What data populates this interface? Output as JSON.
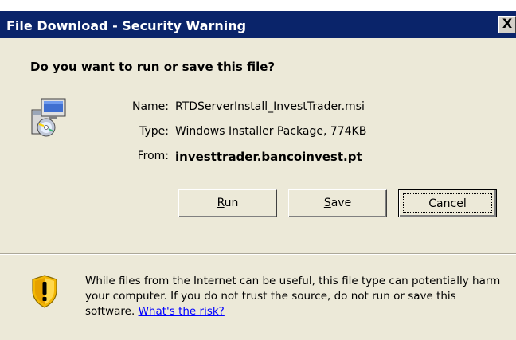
{
  "window": {
    "title": "File Download - Security Warning",
    "close_glyph": "X"
  },
  "dialog": {
    "question": "Do you want to run or save this file?",
    "file": {
      "name_label": "Name:",
      "name_value": "RTDServerInstall_InvestTrader.msi",
      "type_label": "Type:",
      "type_value": "Windows Installer Package, 774KB",
      "from_label": "From:",
      "from_value": "investtrader.bancoinvest.pt"
    },
    "buttons": {
      "run": {
        "accel": "R",
        "rest": "un"
      },
      "save": {
        "accel": "S",
        "rest": "ave"
      },
      "cancel": {
        "label": "Cancel"
      }
    },
    "warning": {
      "text": "While files from the Internet can be useful, this file type can potentially harm your computer. If you do not trust the source, do not run or save this software.",
      "link": "What's the risk?"
    }
  },
  "icons": {
    "file": "msi-installer-icon",
    "warning": "security-shield-icon"
  }
}
